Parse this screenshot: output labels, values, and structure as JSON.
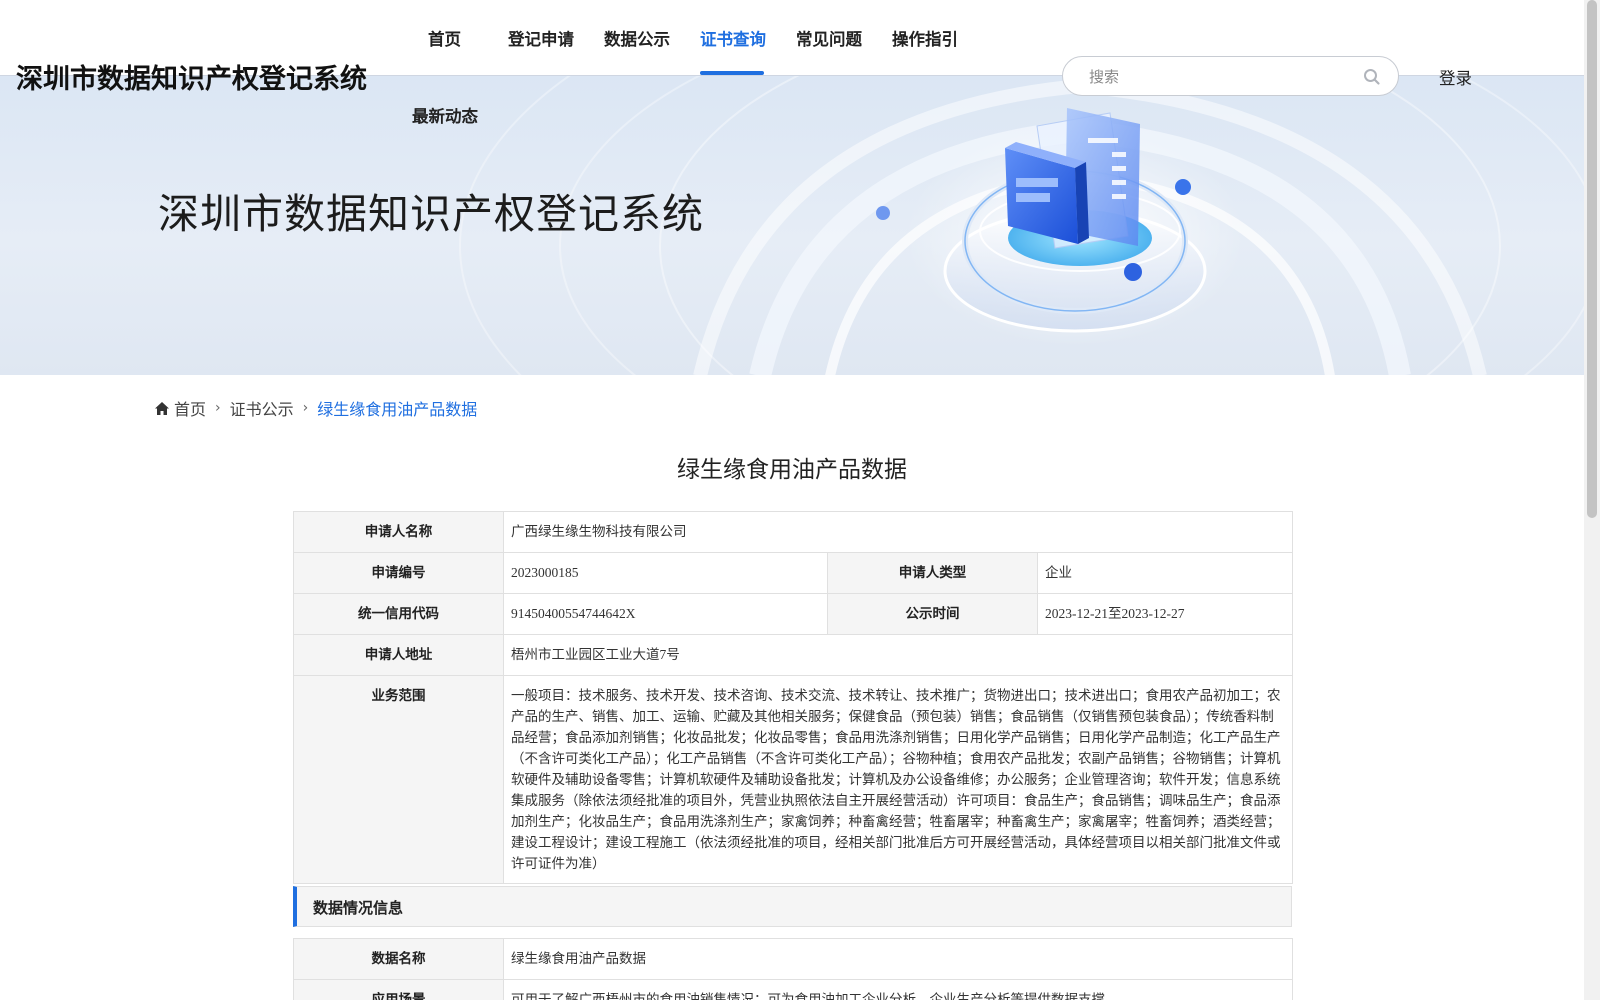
{
  "header": {
    "site_title": "深圳市数据知识产权登记系统",
    "nav": [
      {
        "label": "首页"
      },
      {
        "label": "登记申请"
      },
      {
        "label": "数据公示"
      },
      {
        "label": "证书查询"
      },
      {
        "label": "常见问题"
      },
      {
        "label": "操作指引"
      },
      {
        "label": "最新动态"
      }
    ],
    "active_nav": "证书查询",
    "search_placeholder": "搜索",
    "search_icon": "search-icon",
    "login_label": "登录",
    "accent_color": "#1f6fe0"
  },
  "banner": {
    "title": "深圳市数据知识产权登记系统"
  },
  "breadcrumb": {
    "home": "首页",
    "level2": "证书公示",
    "current": "绿生缘食用油产品数据"
  },
  "page_title": "绿生缘食用油产品数据",
  "info": {
    "applicant_name_label": "申请人名称",
    "applicant_name": "广西绿生缘生物科技有限公司",
    "app_no_label": "申请编号",
    "app_no": "2023000185",
    "applicant_type_label": "申请人类型",
    "applicant_type": "企业",
    "credit_code_label": "统一信用代码",
    "credit_code": "91450400554744642X",
    "publish_time_label": "公示时间",
    "publish_time": "2023-12-21至2023-12-27",
    "address_label": "申请人地址",
    "address": "梧州市工业园区工业大道7号",
    "scope_label": "业务范围",
    "scope": "一般项目：技术服务、技术开发、技术咨询、技术交流、技术转让、技术推广；货物进出口；技术进出口；食用农产品初加工；农产品的生产、销售、加工、运输、贮藏及其他相关服务；保健食品（预包装）销售；食品销售（仅销售预包装食品）；传统香料制品经营；食品添加剂销售；化妆品批发；化妆品零售；食品用洗涤剂销售；日用化学产品销售；日用化学产品制造；化工产品生产（不含许可类化工产品）；化工产品销售（不含许可类化工产品）；谷物种植；食用农产品批发；农副产品销售；谷物销售；计算机软硬件及辅助设备零售；计算机软硬件及辅助设备批发；计算机及办公设备维修；办公服务；企业管理咨询；软件开发；信息系统集成服务（除依法须经批准的项目外，凭营业执照依法自主开展经营活动）许可项目：食品生产；食品销售；调味品生产；食品添加剂生产；化妆品生产；食品用洗涤剂生产；家禽饲养；种畜禽经营；牲畜屠宰；种畜禽生产；家禽屠宰；牲畜饲养；酒类经营；建设工程设计；建设工程施工（依法须经批准的项目，经相关部门批准后方可开展经营活动，具体经营项目以相关部门批准文件或许可证件为准）"
  },
  "data_section": {
    "title": "数据情况信息",
    "data_name_label": "数据名称",
    "data_name": "绿生缘食用油产品数据",
    "scenario_label": "应用场景",
    "scenario": "可用于了解广西梧州市的食用油销售情况；可为食用油加工企业分析、企业生产分析等提供数据支撑。"
  }
}
